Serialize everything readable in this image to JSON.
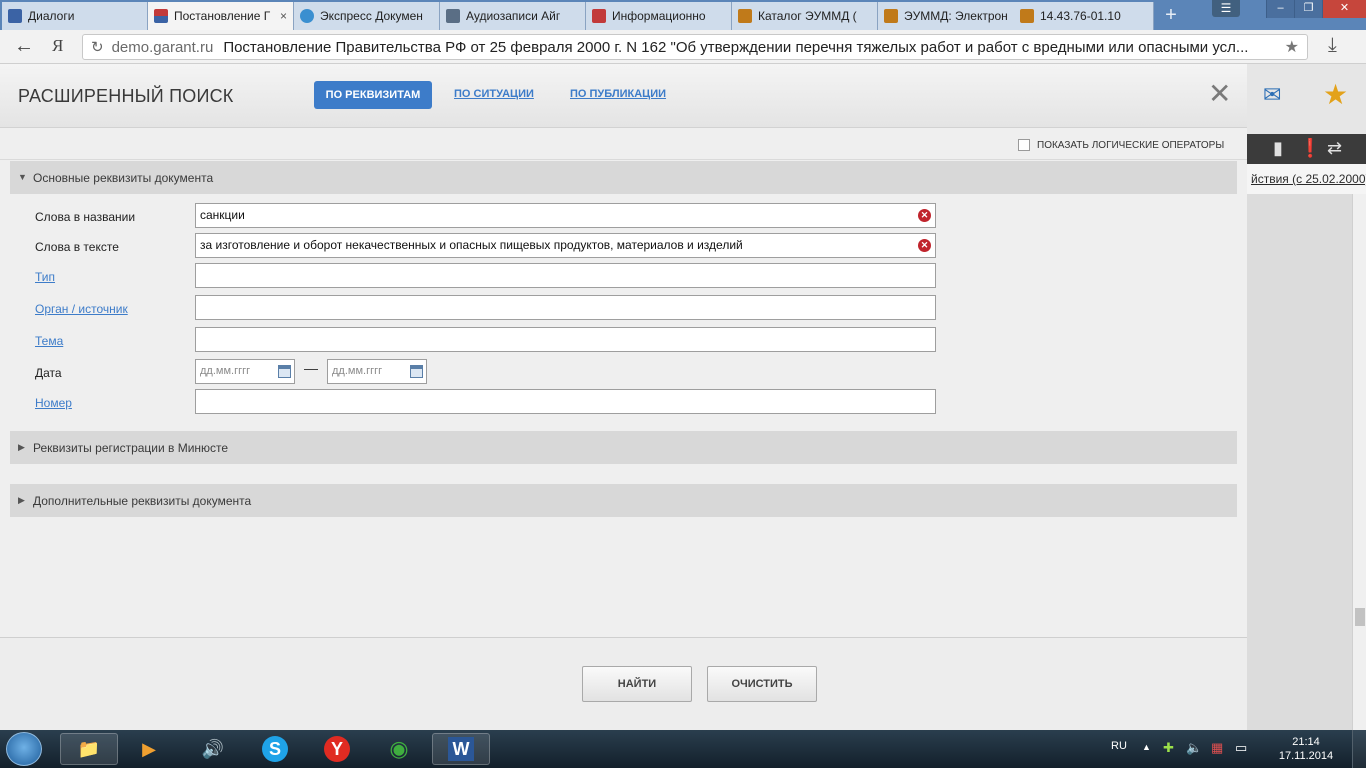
{
  "browser": {
    "tabs": [
      {
        "label": "Диалоги",
        "icon": "play-square-icon",
        "color": "#3b63a5",
        "active": false
      },
      {
        "label": "Постановление Г",
        "icon": "garant-flag-icon",
        "color": "#c23a3a",
        "active": true
      },
      {
        "label": "Экспресс Докумен",
        "icon": "snowflake-icon",
        "color": "#3a8fd0",
        "active": false
      },
      {
        "label": "Аудиозаписи Айг",
        "icon": "pause-square-icon",
        "color": "#5a6e85",
        "active": false
      },
      {
        "label": "Информационно",
        "icon": "kc-logo-icon",
        "color": "#c23a3a",
        "active": false
      },
      {
        "label": "Каталог ЭУММД (",
        "icon": "university-icon",
        "color": "#c07a1a",
        "active": false
      },
      {
        "label": "ЭУММД: Электрон",
        "icon": "university-icon",
        "color": "#c07a1a",
        "active": false
      },
      {
        "label": "14.43.76-01.10",
        "icon": "university-icon",
        "color": "#c07a1a",
        "active": false
      }
    ],
    "tab_close": "×",
    "new_tab": "+",
    "window_buttons": {
      "minimize": "‒",
      "maximize": "❐",
      "close": "✕"
    },
    "menu": "☰",
    "back": "←",
    "yandex_logo": "Я",
    "reload": "↻",
    "domain": "demo.garant.ru",
    "page_title": "Постановление Правительства РФ от 25 февраля 2000 г. N 162 \"Об утверждении перечня тяжелых работ и работ с вредными или опасными усл...",
    "bookmark_star": "★",
    "download": "⤓"
  },
  "background_page": {
    "toolbar_icons": [
      "bookmark-icon",
      "warning-icon",
      "compare-arrows-icon"
    ],
    "toolbar_glyphs": [
      "▮",
      "❗",
      "⇄"
    ],
    "edition_link": "йствия (с 25.02.2000)",
    "mail_glyph": "✉",
    "star_glyph": "★"
  },
  "search": {
    "title": "РАСШИРЕННЫЙ ПОИСК",
    "tabs": {
      "by_attributes": "ПО РЕКВИЗИТАМ",
      "by_situation": "ПО СИТУАЦИИ",
      "by_publication": "ПО ПУБЛИКАЦИИ"
    },
    "close_glyph": "✕",
    "show_logic_operators": "ПОКАЗАТЬ ЛОГИЧЕСКИЕ ОПЕРАТОРЫ",
    "section_main": "Основные реквизиты документа",
    "fields": {
      "title_words_label": "Слова в названии",
      "title_words_value": "санкции",
      "text_words_label": "Слова в тексте",
      "text_words_value": "за изготовление и оборот некачественных и опасных пищевых продуктов, материалов и изделий",
      "type_label": "Тип",
      "source_label": "Орган / источник",
      "topic_label": "Тема",
      "date_label": "Дата",
      "date_from_placeholder": "дд.мм.гггг",
      "date_to_placeholder": "дд.мм.гггг",
      "date_dash": "—",
      "number_label": "Номер",
      "clear_glyph": "✕"
    },
    "section_minjust": "Реквизиты регистрации в Минюсте",
    "section_extra": "Дополнительные реквизиты документа",
    "expanded_glyph": "▼",
    "collapsed_glyph": "▶",
    "find_button": "НАЙТИ",
    "clear_button": "ОЧИСТИТЬ"
  },
  "taskbar": {
    "apps": [
      {
        "name": "explorer",
        "icon": "folder-icon",
        "glyph": "📁"
      },
      {
        "name": "media-player",
        "icon": "media-player-icon",
        "glyph": "▶"
      },
      {
        "name": "audio",
        "icon": "speaker-icon",
        "glyph": "🔊"
      },
      {
        "name": "skype",
        "icon": "skype-icon",
        "glyph": "S"
      },
      {
        "name": "yandex-browser",
        "icon": "yandex-browser-icon",
        "glyph": "Y"
      },
      {
        "name": "chrome",
        "icon": "chrome-icon",
        "glyph": "◉"
      },
      {
        "name": "word",
        "icon": "word-icon",
        "glyph": "W"
      }
    ],
    "language": "RU",
    "tray_glyphs": [
      "▲",
      "✚",
      "🔈",
      "▦",
      "▭"
    ],
    "time": "21:14",
    "date": "17.11.2014"
  },
  "colors": {
    "accent": "#3d7cc9",
    "clear_icon": "#c0242c",
    "star": "#e3a21a"
  }
}
